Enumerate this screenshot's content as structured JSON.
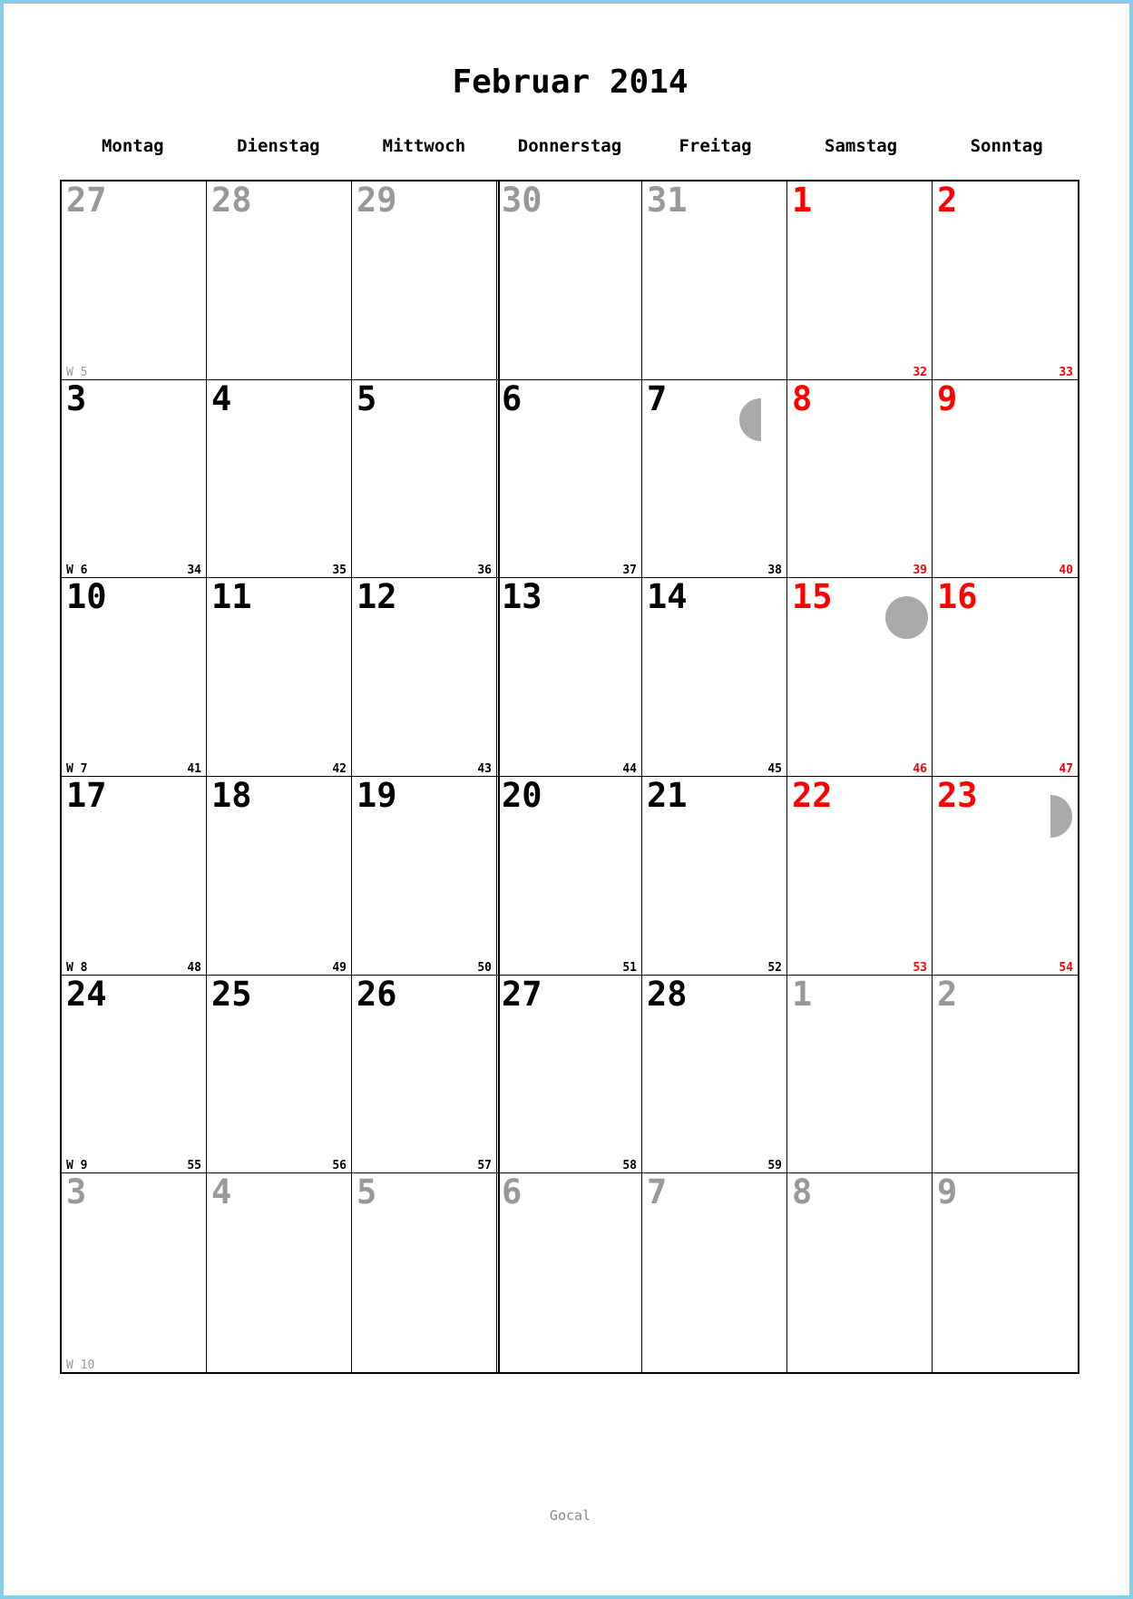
{
  "title": "Februar 2014",
  "footer": "Gocal",
  "colors": {
    "normal": "#000000",
    "weekend": "#ff0000",
    "other_month": "#999999",
    "moon": "#aaaaaa",
    "border": "#87ceeb"
  },
  "weekdays": [
    "Montag",
    "Dienstag",
    "Mittwoch",
    "Donnerstag",
    "Freitag",
    "Samstag",
    "Sonntag"
  ],
  "weeks": [
    {
      "kw": "W 5",
      "kw_faded": true,
      "days": [
        {
          "day": "27",
          "state": "other"
        },
        {
          "day": "28",
          "state": "other"
        },
        {
          "day": "29",
          "state": "other"
        },
        {
          "day": "30",
          "state": "other"
        },
        {
          "day": "31",
          "state": "other"
        },
        {
          "day": "1",
          "state": "weekend",
          "daynum": "32"
        },
        {
          "day": "2",
          "state": "weekend",
          "daynum": "33"
        }
      ]
    },
    {
      "kw": "W 6",
      "kw_faded": false,
      "days": [
        {
          "day": "3",
          "state": "normal",
          "daynum": "34"
        },
        {
          "day": "4",
          "state": "normal",
          "daynum": "35"
        },
        {
          "day": "5",
          "state": "normal",
          "daynum": "36"
        },
        {
          "day": "6",
          "state": "normal",
          "daynum": "37"
        },
        {
          "day": "7",
          "state": "normal",
          "daynum": "38",
          "moon": "last"
        },
        {
          "day": "8",
          "state": "weekend",
          "daynum": "39"
        },
        {
          "day": "9",
          "state": "weekend",
          "daynum": "40"
        }
      ]
    },
    {
      "kw": "W 7",
      "kw_faded": false,
      "days": [
        {
          "day": "10",
          "state": "normal",
          "daynum": "41"
        },
        {
          "day": "11",
          "state": "normal",
          "daynum": "42"
        },
        {
          "day": "12",
          "state": "normal",
          "daynum": "43"
        },
        {
          "day": "13",
          "state": "normal",
          "daynum": "44"
        },
        {
          "day": "14",
          "state": "normal",
          "daynum": "45"
        },
        {
          "day": "15",
          "state": "weekend",
          "daynum": "46",
          "moon": "full"
        },
        {
          "day": "16",
          "state": "weekend",
          "daynum": "47"
        }
      ]
    },
    {
      "kw": "W 8",
      "kw_faded": false,
      "days": [
        {
          "day": "17",
          "state": "normal",
          "daynum": "48"
        },
        {
          "day": "18",
          "state": "normal",
          "daynum": "49"
        },
        {
          "day": "19",
          "state": "normal",
          "daynum": "50"
        },
        {
          "day": "20",
          "state": "normal",
          "daynum": "51"
        },
        {
          "day": "21",
          "state": "normal",
          "daynum": "52"
        },
        {
          "day": "22",
          "state": "weekend",
          "daynum": "53"
        },
        {
          "day": "23",
          "state": "weekend",
          "daynum": "54",
          "moon": "first"
        }
      ]
    },
    {
      "kw": "W 9",
      "kw_faded": false,
      "days": [
        {
          "day": "24",
          "state": "normal",
          "daynum": "55"
        },
        {
          "day": "25",
          "state": "normal",
          "daynum": "56"
        },
        {
          "day": "26",
          "state": "normal",
          "daynum": "57"
        },
        {
          "day": "27",
          "state": "normal",
          "daynum": "58"
        },
        {
          "day": "28",
          "state": "normal",
          "daynum": "59"
        },
        {
          "day": "1",
          "state": "other"
        },
        {
          "day": "2",
          "state": "other"
        }
      ]
    },
    {
      "kw": "W 10",
      "kw_faded": true,
      "days": [
        {
          "day": "3",
          "state": "other"
        },
        {
          "day": "4",
          "state": "other"
        },
        {
          "day": "5",
          "state": "other"
        },
        {
          "day": "6",
          "state": "other"
        },
        {
          "day": "7",
          "state": "other"
        },
        {
          "day": "8",
          "state": "other"
        },
        {
          "day": "9",
          "state": "other"
        }
      ]
    }
  ]
}
